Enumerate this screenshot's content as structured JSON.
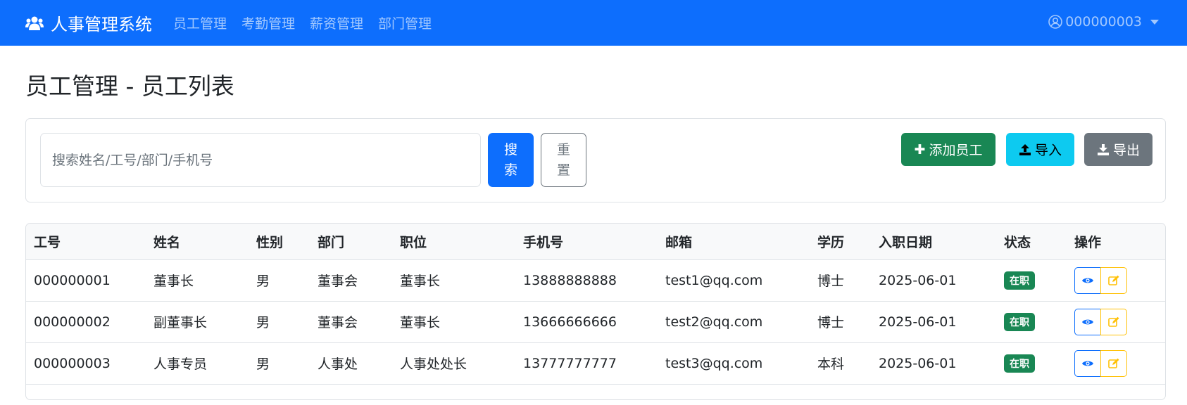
{
  "navbar": {
    "brand": "人事管理系统",
    "links": [
      "员工管理",
      "考勤管理",
      "薪资管理",
      "部门管理"
    ],
    "user": "000000003",
    "colors": {
      "background": "#0d6efd"
    }
  },
  "page": {
    "title": "员工管理 - 员工列表"
  },
  "search": {
    "placeholder": "搜索姓名/工号/部门/手机号",
    "value": "",
    "search_label": "搜索",
    "reset_label": "重置"
  },
  "toolbar": {
    "add_label": "添加员工",
    "import_label": "导入",
    "export_label": "导出"
  },
  "table": {
    "columns": [
      "工号",
      "姓名",
      "性别",
      "部门",
      "职位",
      "手机号",
      "邮箱",
      "学历",
      "入职日期",
      "状态",
      "操作"
    ],
    "rows": [
      {
        "id": "000000001",
        "name": "董事长",
        "gender": "男",
        "dept": "董事会",
        "position": "董事长",
        "phone": "13888888888",
        "email": "test1@qq.com",
        "edu": "博士",
        "date": "2025-06-01",
        "status": "在职"
      },
      {
        "id": "000000002",
        "name": "副董事长",
        "gender": "男",
        "dept": "董事会",
        "position": "董事长",
        "phone": "13666666666",
        "email": "test2@qq.com",
        "edu": "博士",
        "date": "2025-06-01",
        "status": "在职"
      },
      {
        "id": "000000003",
        "name": "人事专员",
        "gender": "男",
        "dept": "人事处",
        "position": "人事处处长",
        "phone": "13777777777",
        "email": "test3@qq.com",
        "edu": "本科",
        "date": "2025-06-01",
        "status": "在职"
      }
    ]
  },
  "icons": {
    "brand": "users-icon",
    "user": "user-circle-icon",
    "add": "plus-icon",
    "import": "upload-icon",
    "export": "download-icon",
    "view": "eye-icon",
    "edit": "edit-icon"
  }
}
